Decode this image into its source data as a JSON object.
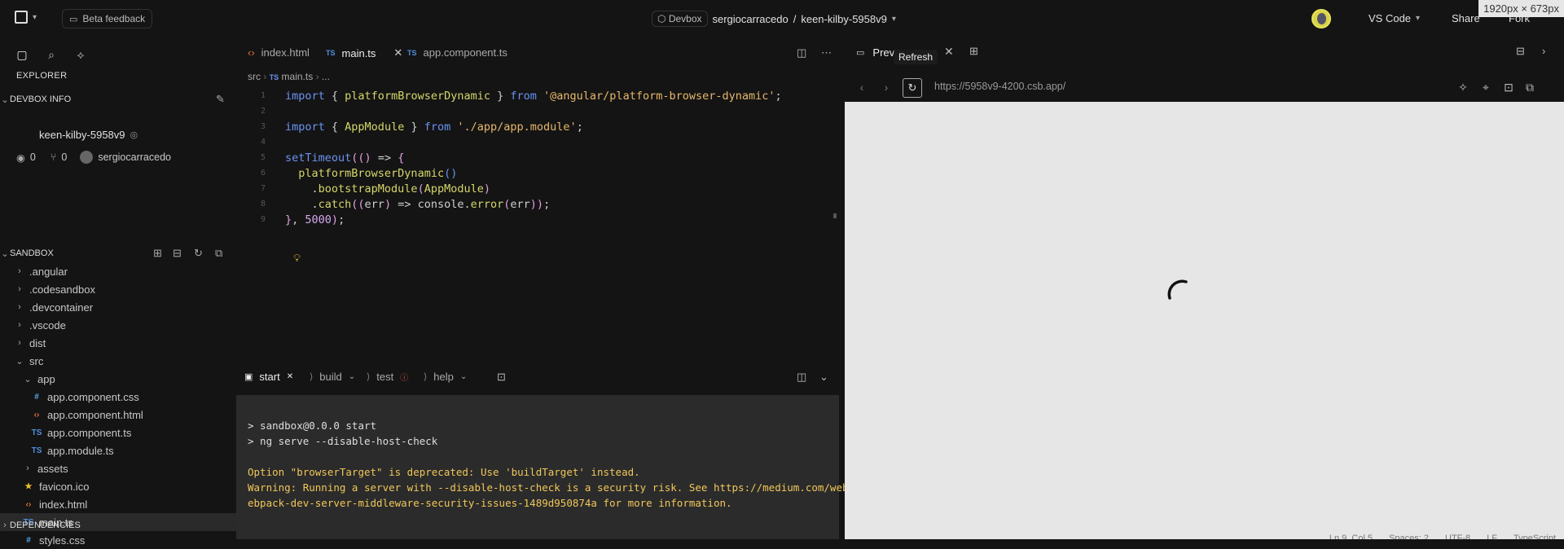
{
  "topbar": {
    "feedback_label": "Beta feedback",
    "devbox_label": "Devbox",
    "owner": "sergiocarracedo",
    "separator": "/",
    "project": "keen-kilby-5958v9",
    "ide_label": "VS Code",
    "share_label": "Share",
    "fork_label": "Fork",
    "dimensions_badge": "1920px × 673px"
  },
  "sidebar": {
    "explorer_title": "EXPLORER",
    "devbox_info_title": "DEVBOX INFO",
    "devbox_name": "keen-kilby-5958v9",
    "views_count": "0",
    "forks_count": "0",
    "owner": "sergiocarracedo",
    "sandbox_title": "SANDBOX",
    "dependencies_title": "DEPENDENCIES",
    "tree": [
      {
        "label": ".angular",
        "type": "folder",
        "depth": 0
      },
      {
        "label": ".codesandbox",
        "type": "folder",
        "depth": 0
      },
      {
        "label": ".devcontainer",
        "type": "folder",
        "depth": 0
      },
      {
        "label": ".vscode",
        "type": "folder",
        "depth": 0
      },
      {
        "label": "dist",
        "type": "folder",
        "depth": 0
      },
      {
        "label": "src",
        "type": "folder-open",
        "depth": 0
      },
      {
        "label": "app",
        "type": "folder-open",
        "depth": 1
      },
      {
        "label": "app.component.css",
        "type": "css",
        "depth": 2
      },
      {
        "label": "app.component.html",
        "type": "html",
        "depth": 2
      },
      {
        "label": "app.component.ts",
        "type": "ts",
        "depth": 2
      },
      {
        "label": "app.module.ts",
        "type": "ts",
        "depth": 2
      },
      {
        "label": "assets",
        "type": "folder",
        "depth": 1
      },
      {
        "label": "favicon.ico",
        "type": "star",
        "depth": 1
      },
      {
        "label": "index.html",
        "type": "html",
        "depth": 1
      },
      {
        "label": "main.ts",
        "type": "ts",
        "depth": 1,
        "active": true
      },
      {
        "label": "styles.css",
        "type": "css",
        "depth": 1
      }
    ]
  },
  "editor": {
    "tabs": [
      {
        "label": "index.html",
        "icon": "html"
      },
      {
        "label": "main.ts",
        "icon": "TS",
        "active": true
      },
      {
        "label": "app.component.ts",
        "icon": "TS"
      }
    ],
    "breadcrumb": {
      "folder": "src",
      "file": "main.ts",
      "more": "..."
    },
    "lines": [
      {
        "n": "1",
        "tokens": [
          [
            "kw",
            "import"
          ],
          [
            "pun",
            " { "
          ],
          [
            "fn",
            "platformBrowserDynamic"
          ],
          [
            "pun",
            " } "
          ],
          [
            "kw",
            "from"
          ],
          [
            "pun",
            " "
          ],
          [
            "str",
            "'@angular/platform-browser-dynamic'"
          ],
          [
            "pun",
            ";"
          ]
        ]
      },
      {
        "n": "2",
        "tokens": []
      },
      {
        "n": "3",
        "tokens": [
          [
            "kw",
            "import"
          ],
          [
            "pun",
            " { "
          ],
          [
            "fn",
            "AppModule"
          ],
          [
            "pun",
            " } "
          ],
          [
            "kw",
            "from"
          ],
          [
            "pun",
            " "
          ],
          [
            "str",
            "'./app/app.module'"
          ],
          [
            "pun",
            ";"
          ]
        ]
      },
      {
        "n": "4",
        "tokens": []
      },
      {
        "n": "5",
        "tokens": [
          [
            "kw",
            "setTimeout"
          ],
          [
            "par",
            "(("
          ],
          [
            "par",
            ")"
          ],
          [
            "pun",
            " => "
          ],
          [
            "par",
            "{"
          ]
        ]
      },
      {
        "n": "6",
        "tokens": [
          [
            "pun",
            "  "
          ],
          [
            "fn",
            "platformBrowserDynamic"
          ],
          [
            "kw",
            "()"
          ]
        ]
      },
      {
        "n": "7",
        "tokens": [
          [
            "pun",
            "    ."
          ],
          [
            "fn",
            "bootstrapModule"
          ],
          [
            "par",
            "("
          ],
          [
            "fn",
            "AppModule"
          ],
          [
            "par",
            ")"
          ]
        ]
      },
      {
        "n": "8",
        "tokens": [
          [
            "pun",
            "    ."
          ],
          [
            "fn",
            "catch"
          ],
          [
            "par",
            "(("
          ],
          [
            "pun",
            "err"
          ],
          [
            "par",
            ")"
          ],
          [
            "pun",
            " => console."
          ],
          [
            "fn",
            "error"
          ],
          [
            "par",
            "("
          ],
          [
            "pun",
            "err"
          ],
          [
            "par",
            "))"
          ],
          [
            "pun",
            ";"
          ]
        ]
      },
      {
        "n": "9",
        "tokens": [
          [
            "par",
            "}"
          ],
          [
            "pun",
            ", "
          ],
          [
            "num",
            "5000"
          ],
          [
            "par",
            ")"
          ],
          [
            "pun",
            ";"
          ]
        ]
      }
    ]
  },
  "terminal": {
    "tabs": [
      {
        "label": "start",
        "active": true
      },
      {
        "label": "build"
      },
      {
        "label": "test"
      },
      {
        "label": "help"
      }
    ],
    "lines": [
      {
        "text": "> sandbox@0.0.0 start",
        "kind": "normal"
      },
      {
        "text": "> ng serve --disable-host-check",
        "kind": "normal"
      },
      {
        "text": "",
        "kind": "normal"
      },
      {
        "text": "Option \"browserTarget\" is deprecated: Use 'buildTarget' instead.",
        "kind": "warn"
      },
      {
        "text": "Warning: Running a server with --disable-host-check is a security risk. See https://medium.com/webpack/w",
        "kind": "warn"
      },
      {
        "text": "ebpack-dev-server-middleware-security-issues-1489d950874a for more information.",
        "kind": "warn"
      }
    ]
  },
  "preview": {
    "tab_label": "Prev",
    "tooltip": "Refresh",
    "url": "https://5958v9-4200.csb.app/"
  },
  "statusbar": {
    "position": "Ln 9, Col 5",
    "spaces": "Spaces: 2",
    "encoding": "UTF-8",
    "eol": "LF",
    "language": "TypeScript"
  }
}
